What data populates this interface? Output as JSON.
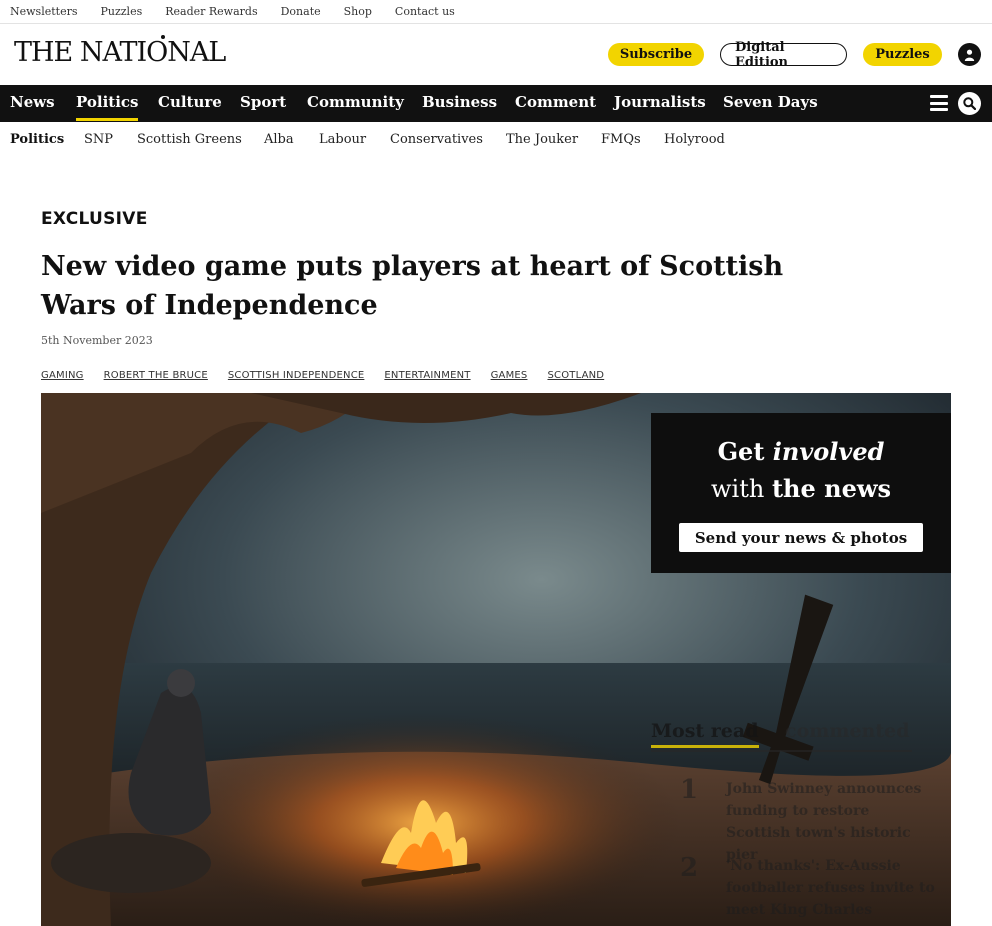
{
  "utility_nav": [
    "Newsletters",
    "Puzzles",
    "Reader Rewards",
    "Donate",
    "Shop",
    "Contact us"
  ],
  "masthead": {
    "logo_text": "THE NATIONAL",
    "subscribe": "Subscribe",
    "digital_edition": "Digital Edition",
    "puzzles": "Puzzles"
  },
  "main_nav": [
    "News",
    "Politics",
    "Culture",
    "Sport",
    "Community",
    "Business",
    "Comment",
    "Journalists",
    "Seven Days"
  ],
  "main_nav_active": "Politics",
  "sub_nav": [
    "Politics",
    "SNP",
    "Scottish Greens",
    "Alba",
    "Labour",
    "Conservatives",
    "The Jouker",
    "FMQs",
    "Holyrood"
  ],
  "article": {
    "kicker": "EXCLUSIVE",
    "headline": "New video game puts players at heart of Scottish Wars of Independence",
    "date": "5th November 2023",
    "tags": [
      "GAMING",
      "ROBERT THE BRUCE",
      "SCOTTISH INDEPENDENCE",
      "ENTERTAINMENT",
      "GAMES",
      "SCOTLAND"
    ]
  },
  "promo": {
    "get": "Get",
    "involved": "involved",
    "with": "with",
    "the_news": "the news",
    "cta": "Send your news & photos"
  },
  "most_read": {
    "tab_read": "Most read",
    "tab_commented": "commented",
    "items": [
      {
        "rank": "1",
        "title": "John Swinney announces funding to restore Scottish town's historic pier"
      },
      {
        "rank": "2",
        "title": "'No thanks': Ex-Aussie footballer refuses invite to meet King Charles"
      }
    ]
  },
  "colors": {
    "accent": "#f2d400",
    "nav_bg": "#111111"
  }
}
